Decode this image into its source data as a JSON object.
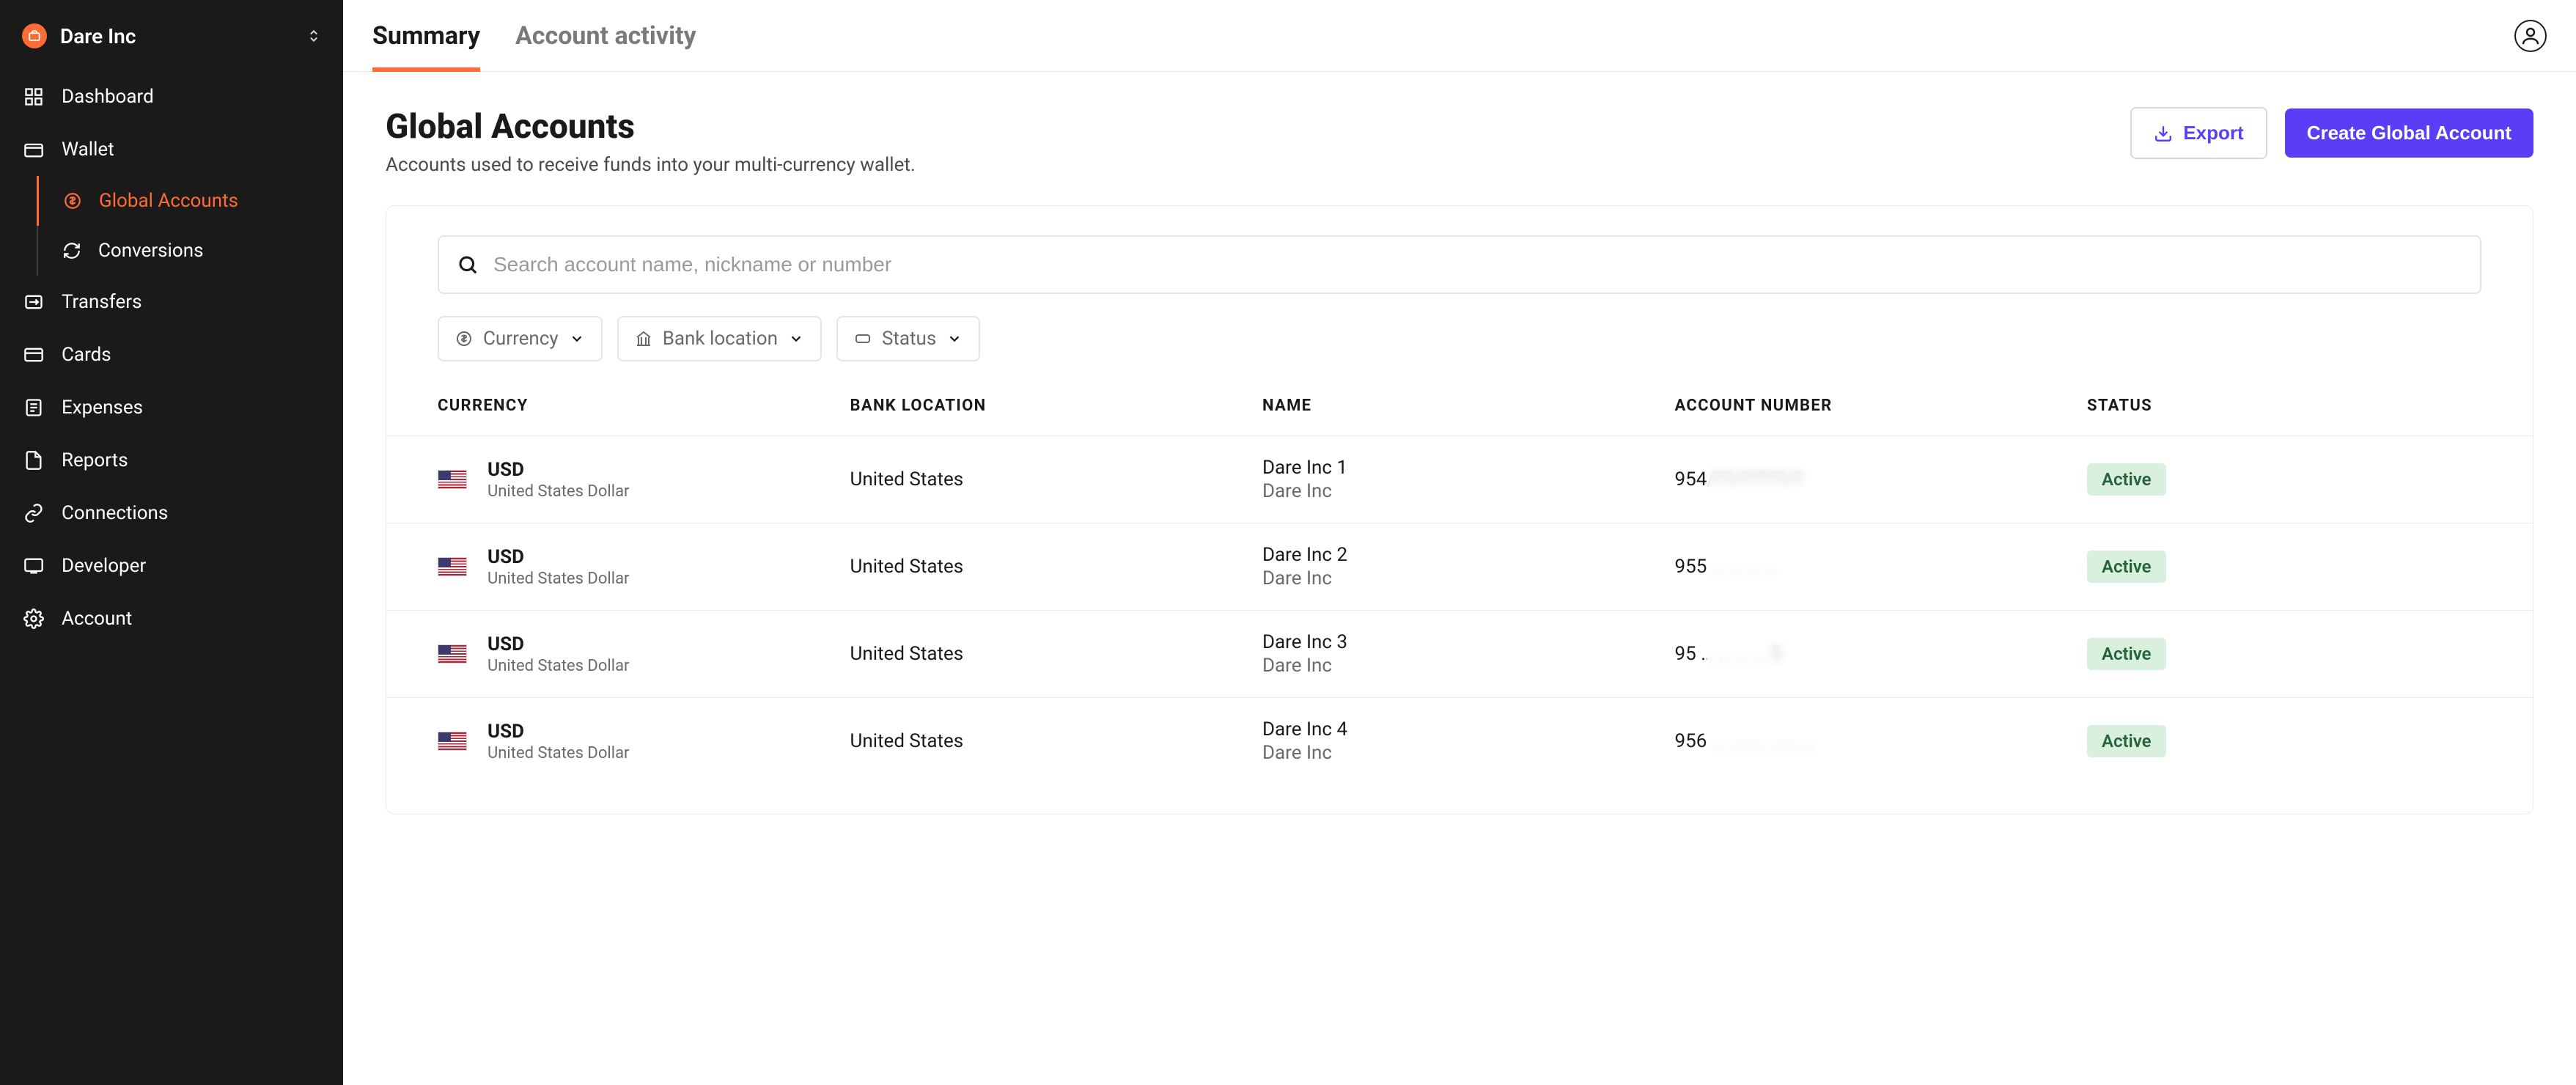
{
  "org": {
    "name": "Dare Inc"
  },
  "sidebar": {
    "items": [
      {
        "label": "Dashboard",
        "icon": "dashboard-icon"
      },
      {
        "label": "Wallet",
        "icon": "wallet-icon"
      },
      {
        "label": "Transfers",
        "icon": "transfers-icon"
      },
      {
        "label": "Cards",
        "icon": "cards-icon"
      },
      {
        "label": "Expenses",
        "icon": "expenses-icon"
      },
      {
        "label": "Reports",
        "icon": "reports-icon"
      },
      {
        "label": "Connections",
        "icon": "connections-icon"
      },
      {
        "label": "Developer",
        "icon": "developer-icon"
      },
      {
        "label": "Account",
        "icon": "account-icon"
      }
    ],
    "wallet_sub": [
      {
        "label": "Global Accounts",
        "active": true
      },
      {
        "label": "Conversions",
        "active": false
      }
    ]
  },
  "tabs": [
    {
      "label": "Summary",
      "active": true
    },
    {
      "label": "Account activity",
      "active": false
    }
  ],
  "page": {
    "title": "Global Accounts",
    "subtitle": "Accounts used to receive funds into your multi-currency wallet."
  },
  "actions": {
    "export_label": "Export",
    "create_label": "Create Global Account"
  },
  "search": {
    "placeholder": "Search account name, nickname or number"
  },
  "filters": [
    {
      "label": "Currency",
      "icon": "currency-icon"
    },
    {
      "label": "Bank location",
      "icon": "bank-icon"
    },
    {
      "label": "Status",
      "icon": "status-icon"
    }
  ],
  "table": {
    "columns": [
      "CURRENCY",
      "BANK LOCATION",
      "NAME",
      "ACCOUNT NUMBER",
      "STATUS"
    ],
    "rows": [
      {
        "currency_code": "USD",
        "currency_name": "United States Dollar",
        "flag": "us",
        "bank_location": "United States",
        "name": "Dare Inc 1",
        "subname": "Dare Inc",
        "account_prefix": "95",
        "account_rest": "4/??/?????/?",
        "status": "Active"
      },
      {
        "currency_code": "USD",
        "currency_name": "United States Dollar",
        "flag": "us",
        "bank_location": "United States",
        "name": "Dare Inc 2",
        "subname": "Dare Inc",
        "account_prefix": "95",
        "account_rest": "5 … … … …",
        "status": "Active"
      },
      {
        "currency_code": "USD",
        "currency_name": "United States Dollar",
        "flag": "us",
        "bank_location": "United States",
        "name": "Dare Inc 3",
        "subname": "Dare Inc",
        "account_prefix": "95",
        "account_rest": " … … … … 5",
        "status": "Active"
      },
      {
        "currency_code": "USD",
        "currency_name": "United States Dollar",
        "flag": "us",
        "bank_location": "United States",
        "name": "Dare Inc 4",
        "subname": "Dare Inc",
        "account_prefix": "956",
        "account_rest": " … ……… …… …",
        "status": "Active"
      }
    ]
  },
  "colors": {
    "accent_orange": "#ff6b35",
    "primary_purple": "#5b3df5",
    "sidebar_bg": "#1a1a1a",
    "status_active_bg": "#d9f0df",
    "status_active_fg": "#25633a"
  }
}
